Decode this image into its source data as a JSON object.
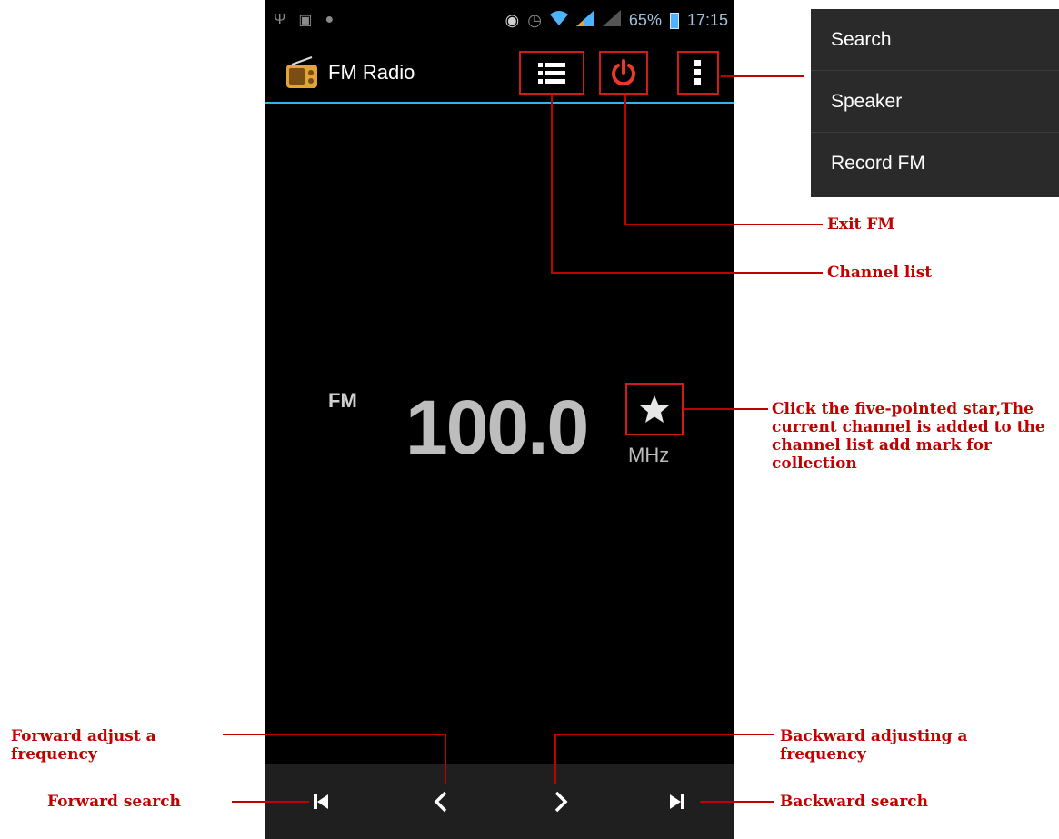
{
  "status_bar": {
    "battery": "65%",
    "time": "17:15",
    "left_icons": [
      "usb-icon",
      "sim-icon",
      "notification-icon"
    ],
    "right_icons": [
      "headset-icon",
      "alarm-icon",
      "wifi-icon",
      "signal-icon",
      "signal-icon",
      "battery-icon"
    ]
  },
  "action_bar": {
    "title": "FM Radio",
    "icons": [
      "radio-app-icon",
      "channel-list-icon",
      "power-icon",
      "overflow-menu-icon"
    ]
  },
  "tuner": {
    "band": "FM",
    "frequency": "100.0",
    "unit": "MHz",
    "favorite_icon": "star-icon"
  },
  "bottom_bar": {
    "icons": [
      "skip-previous-icon",
      "chevron-left-icon",
      "chevron-right-icon",
      "skip-next-icon"
    ]
  },
  "overflow_menu": {
    "items": [
      "Search",
      "Speaker",
      "Record FM"
    ]
  },
  "annotations": {
    "exit_fm": "Exit FM",
    "channel_list": "Channel list",
    "star": "Click the five-pointed star,The current channel is added to the channel list add mark for collection",
    "forward_adjust": "Forward adjust a frequency",
    "backward_adjust": "Backward adjusting a frequency",
    "forward_search": "Forward search",
    "backward_search": "Backward search"
  },
  "colors": {
    "annotation": "#c10000",
    "accent": "#33b5e5",
    "power": "#e8392c",
    "screen_bg": "#000000"
  }
}
